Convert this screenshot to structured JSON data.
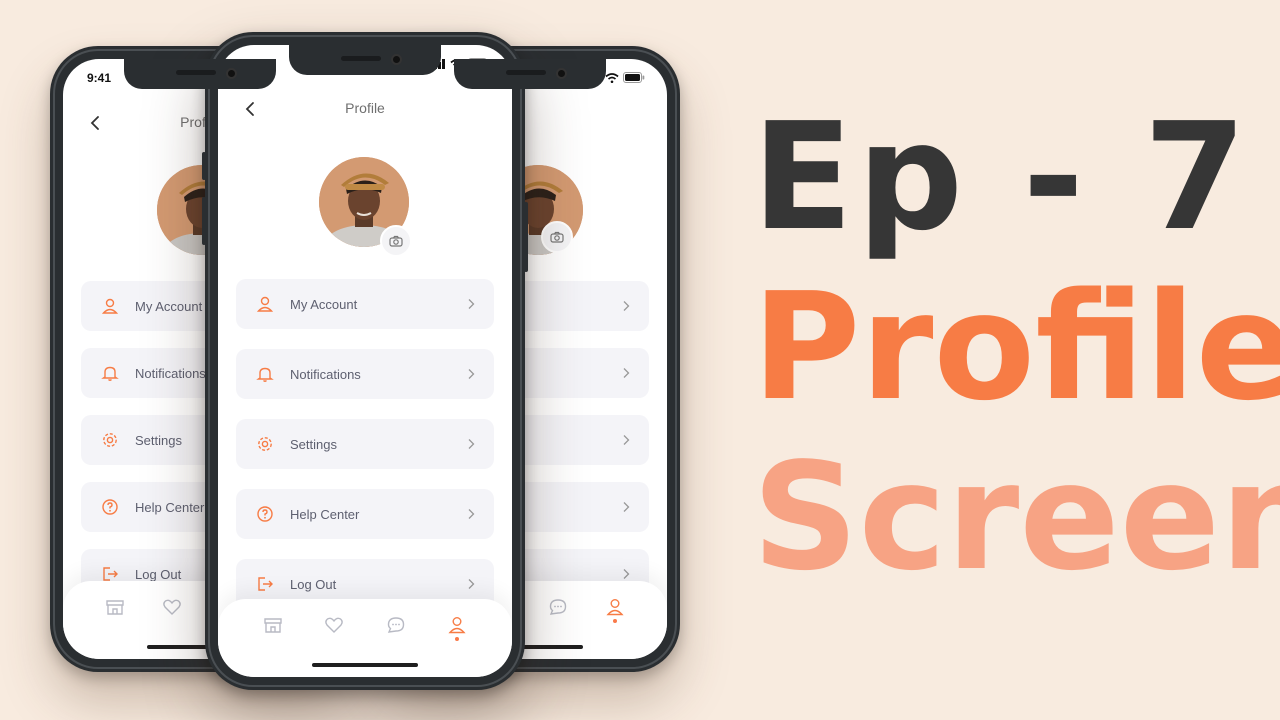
{
  "headline": {
    "episode": "Ep - 7",
    "line2": "Profile",
    "line3": "Screen"
  },
  "phone": {
    "status_time": "9:41",
    "header_title": "Profile",
    "menu": [
      {
        "icon": "user-icon",
        "label": "My Account"
      },
      {
        "icon": "bell-icon",
        "label": "Notifications"
      },
      {
        "icon": "gear-icon",
        "label": "Settings"
      },
      {
        "icon": "help-icon",
        "label": "Help Center"
      },
      {
        "icon": "logout-icon",
        "label": "Log Out"
      }
    ],
    "tabs": [
      "shop-icon",
      "heart-icon",
      "chat-icon",
      "user-icon"
    ],
    "active_tab": "user-icon"
  },
  "colors": {
    "background": "#f8ebdf",
    "accent": "#f77c45",
    "accent_light": "#f7a384",
    "dark_text": "#363636",
    "menu_bg": "#f4f4f8"
  }
}
